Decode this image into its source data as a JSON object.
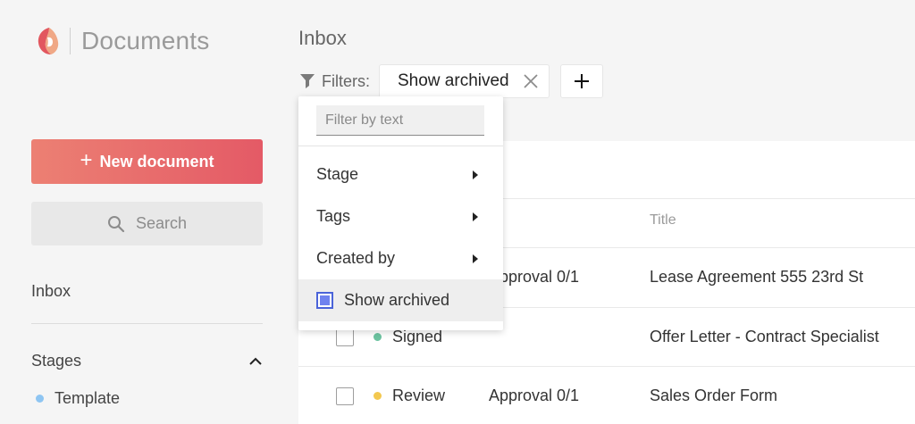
{
  "app": {
    "title": "Documents"
  },
  "sidebar": {
    "new_document_label": "New document",
    "search_label": "Search",
    "inbox_label": "Inbox",
    "stages_heading": "Stages",
    "stages": [
      {
        "label": "Template",
        "color": "#8ec5f2"
      }
    ]
  },
  "main": {
    "title": "Inbox",
    "filters_label": "Filters:",
    "active_filter_chip": "Show archived",
    "table": {
      "title_header": "Title",
      "rows": [
        {
          "stage": "",
          "stage_color": "",
          "approval": "Approval 0/1",
          "title": "Lease Agreement 555 23rd St"
        },
        {
          "stage": "Signed",
          "stage_color": "#6cc3a0",
          "approval": "",
          "title": "Offer Letter - Contract Specialist"
        },
        {
          "stage": "Review",
          "stage_color": "#f3c84f",
          "approval": "Approval 0/1",
          "title": "Sales Order Form"
        }
      ]
    }
  },
  "filter_menu": {
    "placeholder": "Filter by text",
    "items": [
      {
        "label": "Stage"
      },
      {
        "label": "Tags"
      },
      {
        "label": "Created by"
      }
    ],
    "show_archived_label": "Show archived",
    "show_archived_checked": true
  },
  "colors": {
    "accent_gradient_start": "#ec8073",
    "accent_gradient_end": "#e45a66",
    "checkbox_blue": "#4a63d9"
  }
}
